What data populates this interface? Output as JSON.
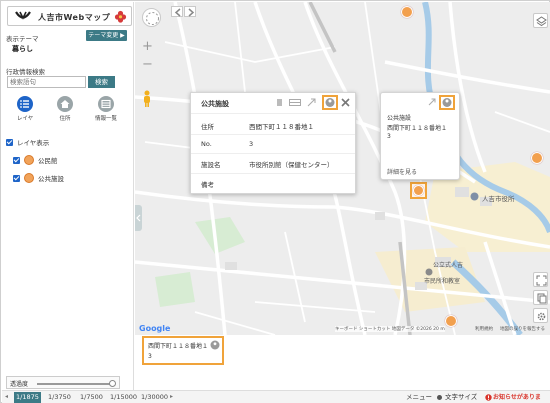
{
  "app": {
    "logo_text": "人吉市Webマップ"
  },
  "sidebar": {
    "theme_label": "表示テーマ",
    "theme_value": "暮らし",
    "theme_button": "テーマ変更 ▶",
    "admin_search_label": "行政情報検索",
    "search_placeholder": "検索語句",
    "search_button": "検索",
    "tools": [
      {
        "label": "レイヤ",
        "icon": "list-icon",
        "color": "#1e64c8"
      },
      {
        "label": "住所",
        "icon": "house-icon",
        "color": "#9aa5a8"
      },
      {
        "label": "情報一覧",
        "icon": "table-icon",
        "color": "#9aa5a8"
      }
    ],
    "layer_toggle_label": "レイヤ表示",
    "layers": [
      {
        "label": "公民館",
        "icon": "community-hall-icon"
      },
      {
        "label": "公共施設",
        "icon": "public-facility-icon"
      }
    ],
    "transparency_label": "透過度"
  },
  "popup_main": {
    "title": "公共施設",
    "rows": [
      {
        "key": "住所",
        "value": "西間下町１１８番地１"
      },
      {
        "key": "No.",
        "value": "3"
      },
      {
        "key": "施設名",
        "value": "市役所別館（保健センター）"
      },
      {
        "key": "備考",
        "value": ""
      }
    ]
  },
  "popup_small": {
    "category": "公共施設",
    "address": "西間下町１１８番地１",
    "no": "3",
    "detail_link": "詳細を見る"
  },
  "map_labels": {
    "city_hall": "人吉市役所",
    "community_center_1": "公立式人吉",
    "community_center_2": "市民所和教室",
    "google": "Google",
    "attribution": "キーボード ショートカット   地図データ ©2026   20 m",
    "terms": "利用規約",
    "report": "地図の誤りを報告する"
  },
  "bottom_panel": {
    "address": "西間下町１１８番地１",
    "no": "3"
  },
  "footer": {
    "scales": [
      "1/1875",
      "1/3750",
      "1/7500",
      "1/15000",
      "1/30000"
    ],
    "active_scale_index": 0,
    "menu": "メニュー",
    "font_size": "文字サイズ",
    "notice": "お知らせがあります。"
  },
  "colors": {
    "accent": "#3c7a86",
    "highlight": "#f0a33a",
    "poi": "#f2a04e",
    "notice": "#d9342b"
  }
}
